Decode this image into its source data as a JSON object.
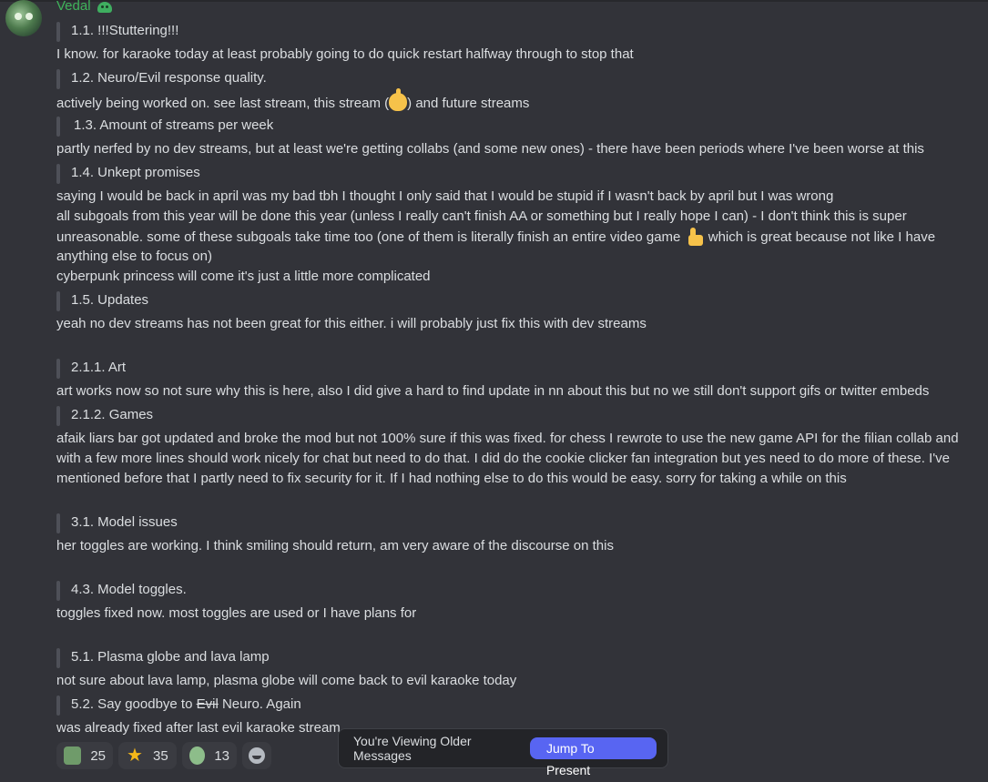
{
  "message": {
    "author": "Vedal",
    "sections": [
      {
        "quote": "1.1. !!!Stuttering!!!",
        "reply": [
          "I know. for karaoke today at least probably going to do quick restart halfway through to stop that"
        ]
      },
      {
        "quote": "1.2. Neuro/Evil response quality.",
        "reply_pre": "actively being worked on. see last stream, this stream (",
        "reply_post": ") and future streams"
      },
      {
        "quote": "1.3. Amount of streams per week",
        "reply": [
          "partly nerfed by no dev streams, but at least we're getting collabs (and some new ones) - there have been periods where I've been worse at this"
        ]
      },
      {
        "quote": "1.4. Unkept promises",
        "reply": [
          "saying I would be back in april was my bad tbh I thought I only said that I would be stupid if I wasn't back by april but I was wrong",
          "all subgoals from this year will be done this year (unless I really can't finish AA or something but I really hope I can) - I don't think this is super",
          "unreasonable. some of these subgoals take time too (one of them is literally finish an entire video game",
          "which is great because not like I have",
          "anything else to focus on)",
          "cyberpunk princess will come it's just a little more complicated"
        ]
      },
      {
        "quote": "1.5. Updates",
        "reply": [
          "yeah no dev streams has not been great for this either. i will probably just fix this with dev streams"
        ]
      },
      {
        "quote": "2.1.1. Art",
        "reply": [
          "art works now so not sure why this is here, also I did give a hard to find update in nn about this but no we still don't support gifs or twitter embeds"
        ]
      },
      {
        "quote": "2.1.2. Games",
        "reply": [
          "afaik liars bar got updated and broke the mod but not 100% sure if this was fixed. for chess I rewrote to use the new game API for the filian collab and",
          "with a few more lines should work nicely for chat but need to do that. I did do the cookie clicker fan integration but yes need to do more of these. I've",
          "mentioned before that I partly need to fix security for it. If I had nothing else to do this would be easy. sorry for taking a while on this"
        ]
      },
      {
        "quote": "3.1. Model issues",
        "reply": [
          "her toggles are working. I think smiling should return, am very aware of the discourse on this"
        ]
      },
      {
        "quote": "4.3. Model toggles.",
        "reply": [
          "toggles fixed now. most toggles are used or I have plans for"
        ]
      },
      {
        "quote": "5.1. Plasma globe and lava lamp",
        "reply": [
          "not sure about lava lamp, plasma globe will come back to evil karaoke today"
        ]
      },
      {
        "quote_pre": "5.2. Say goodbye to ",
        "quote_strike": "Evil",
        "quote_post": " Neuro. Again",
        "reply": [
          "was already fixed after last evil karaoke stream"
        ]
      }
    ]
  },
  "reactions": [
    {
      "icon": "frog-emoji-icon",
      "count": "25"
    },
    {
      "icon": "star-emoji-icon",
      "count": "35"
    },
    {
      "icon": "tree-emoji-icon",
      "count": "13"
    }
  ],
  "older_bar": {
    "text": "You're Viewing Older Messages",
    "button": "Jump To Present"
  }
}
